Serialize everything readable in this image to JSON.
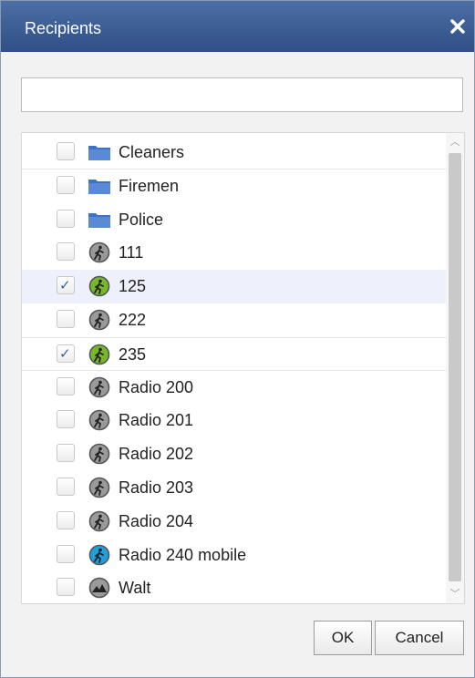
{
  "dialog": {
    "title": "Recipients",
    "close_label": "×"
  },
  "search": {
    "value": "",
    "placeholder": ""
  },
  "recipients": [
    {
      "label": "Cleaners",
      "checked": false,
      "icon": "folder-icon",
      "icon_color": "#3d73c4"
    },
    {
      "label": "Firemen",
      "checked": false,
      "icon": "folder-icon",
      "icon_color": "#3d73c4"
    },
    {
      "label": "Police",
      "checked": false,
      "icon": "folder-icon",
      "icon_color": "#3d73c4"
    },
    {
      "label": "111",
      "checked": false,
      "icon": "radio-user-icon",
      "icon_color": "#9a9a9a"
    },
    {
      "label": "125",
      "checked": true,
      "icon": "radio-user-icon",
      "icon_color": "#76b82a"
    },
    {
      "label": "222",
      "checked": false,
      "icon": "radio-user-icon",
      "icon_color": "#9a9a9a"
    },
    {
      "label": "235",
      "checked": true,
      "icon": "radio-user-icon",
      "icon_color": "#76b82a"
    },
    {
      "label": "Radio 200",
      "checked": false,
      "icon": "radio-user-icon",
      "icon_color": "#9a9a9a"
    },
    {
      "label": "Radio 201",
      "checked": false,
      "icon": "radio-user-icon",
      "icon_color": "#9a9a9a"
    },
    {
      "label": "Radio 202",
      "checked": false,
      "icon": "radio-user-icon",
      "icon_color": "#9a9a9a"
    },
    {
      "label": "Radio 203",
      "checked": false,
      "icon": "radio-user-icon",
      "icon_color": "#9a9a9a"
    },
    {
      "label": "Radio 204",
      "checked": false,
      "icon": "radio-user-icon",
      "icon_color": "#9a9a9a"
    },
    {
      "label": "Radio 240 mobile",
      "checked": false,
      "icon": "radio-user-icon",
      "icon_color": "#1ea0dc"
    },
    {
      "label": "Walt",
      "checked": false,
      "icon": "mountain-user-icon",
      "icon_color": "#9a9a9a"
    }
  ],
  "buttons": {
    "ok": "OK",
    "cancel": "Cancel"
  },
  "colors": {
    "titlebar": "#3a5d96",
    "selected_row": "#eef0fb",
    "check": "#3a5fa0"
  }
}
